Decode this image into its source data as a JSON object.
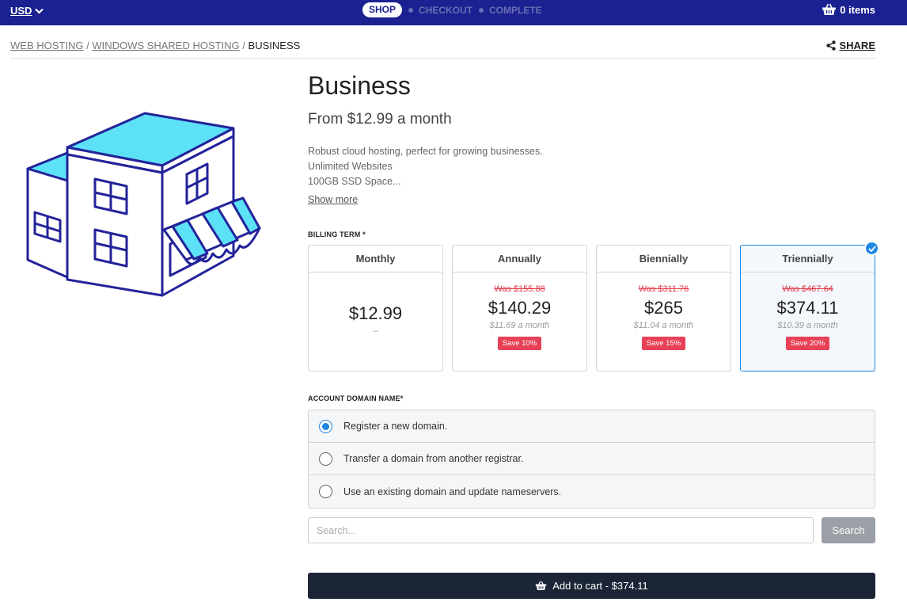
{
  "topbar": {
    "currency": "USD",
    "steps": [
      {
        "label": "SHOP",
        "active": true
      },
      {
        "label": "CHECKOUT",
        "active": false
      },
      {
        "label": "COMPLETE",
        "active": false
      }
    ],
    "cart_label": "0 items"
  },
  "breadcrumb": {
    "items": [
      "WEB HOSTING",
      "WINDOWS SHARED HOSTING"
    ],
    "separator": "/",
    "current": "BUSINESS"
  },
  "share_label": "SHARE",
  "product": {
    "title": "Business",
    "from_price": "From $12.99 a month",
    "description": [
      "Robust cloud hosting, perfect for growing businesses.",
      "Unlimited Websites",
      "100GB SSD Space..."
    ],
    "show_more": "Show more"
  },
  "billing": {
    "label": "BILLING TERM *",
    "terms": [
      {
        "name": "Monthly",
        "was": "",
        "price": "$12.99",
        "monthly": "",
        "dash": "–",
        "save": "",
        "selected": false
      },
      {
        "name": "Annually",
        "was": "Was $155.88",
        "price": "$140.29",
        "monthly": "$11.69 a month",
        "save": "Save 10%",
        "selected": false
      },
      {
        "name": "Biennially",
        "was": "Was $311.76",
        "price": "$265",
        "monthly": "$11.04 a month",
        "save": "Save 15%",
        "selected": false
      },
      {
        "name": "Triennially",
        "was": "Was $467.64",
        "price": "$374.11",
        "monthly": "$10.39 a month",
        "save": "Save 20%",
        "selected": true
      }
    ]
  },
  "domain": {
    "label": "ACCOUNT DOMAIN NAME*",
    "options": [
      {
        "label": "Register a new domain.",
        "selected": true
      },
      {
        "label": "Transfer a domain from another registrar.",
        "selected": false
      },
      {
        "label": "Use an existing domain and update nameservers.",
        "selected": false
      }
    ],
    "search_placeholder": "Search...",
    "search_button": "Search"
  },
  "add_to_cart": "Add to cart - $374.11",
  "colors": {
    "topbar": "#1b2191",
    "accent": "#1e88e5",
    "save_badge": "#e84157",
    "cart_button": "#1c2536",
    "illustration_roof": "#5ce1f7",
    "illustration_stroke": "#23239a"
  },
  "icons": {
    "currency": "chevron-down-icon",
    "cart": "basket-icon",
    "share": "share-icon",
    "check": "check-icon",
    "add_to_cart": "basket-icon"
  }
}
